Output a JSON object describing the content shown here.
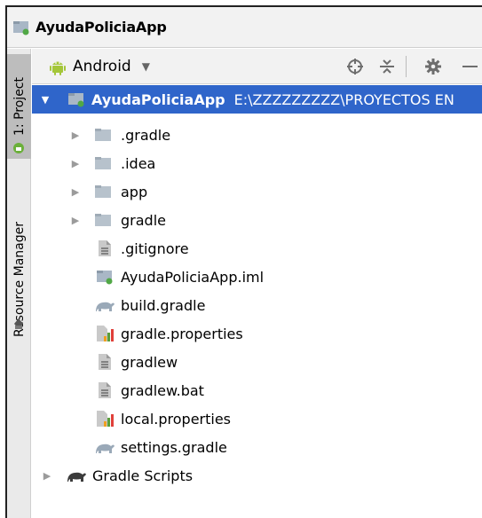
{
  "window": {
    "title": "AyudaPoliciaApp"
  },
  "side_tabs": {
    "project": "1: Project",
    "resource_manager": "Resource Manager"
  },
  "toolbar": {
    "view": "Android"
  },
  "tree": {
    "root": {
      "name": "AyudaPoliciaApp",
      "path": "E:\\ZZZZZZZZZ\\PROYECTOS EN"
    },
    "items": [
      {
        "label": ".gradle",
        "icon": "folder-icon"
      },
      {
        "label": ".idea",
        "icon": "folder-icon"
      },
      {
        "label": "app",
        "icon": "folder-icon"
      },
      {
        "label": "gradle",
        "icon": "folder-icon"
      },
      {
        "label": ".gitignore",
        "icon": "text-file-icon"
      },
      {
        "label": "AyudaPoliciaApp.iml",
        "icon": "module-icon"
      },
      {
        "label": "build.gradle",
        "icon": "gradle-elephant-icon"
      },
      {
        "label": "gradle.properties",
        "icon": "properties-icon"
      },
      {
        "label": "gradlew",
        "icon": "text-file-icon"
      },
      {
        "label": "gradlew.bat",
        "icon": "text-file-icon"
      },
      {
        "label": "local.properties",
        "icon": "properties-icon"
      },
      {
        "label": "settings.gradle",
        "icon": "gradle-elephant-icon"
      }
    ],
    "scripts": {
      "label": "Gradle Scripts",
      "icon": "gradle-elephant-icon"
    }
  }
}
